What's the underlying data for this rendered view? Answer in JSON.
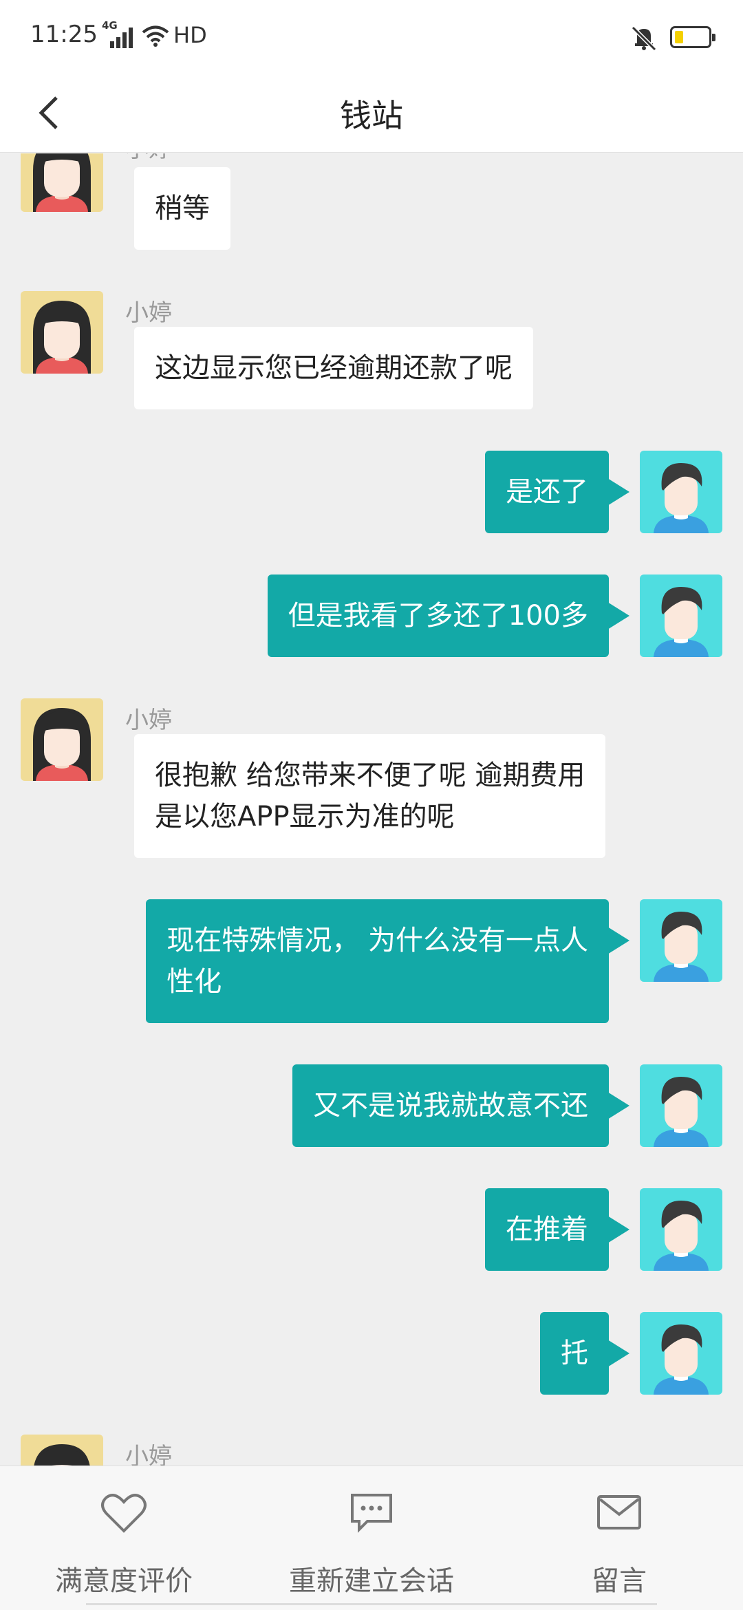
{
  "status_bar": {
    "time": "11:25",
    "network": "4G",
    "hd": "HD"
  },
  "header": {
    "title": "钱站"
  },
  "colors": {
    "accent": "#13a9a7",
    "agent_avatar_bg": "#f0dc97",
    "user_avatar_bg": "#4fdde0"
  },
  "messages": [
    {
      "sender": "小婷",
      "text": "稍等"
    },
    {
      "sender": "小婷",
      "text": "这边显示您已经逾期还款了呢"
    },
    {
      "text": "是还了"
    },
    {
      "text": "但是我看了多还了100多"
    },
    {
      "sender": "小婷",
      "lines": [
        "很抱歉 给您带来不便了呢 逾期费用",
        "是以您APP显示为准的呢"
      ]
    },
    {
      "lines": [
        "现在特殊情况， 为什么没有一点人",
        "性化"
      ]
    },
    {
      "text": "又不是说我就故意不还"
    },
    {
      "text": "在推着"
    },
    {
      "text": "托"
    },
    {
      "sender": "小婷"
    }
  ],
  "bottom_bar": {
    "rate": "满意度评价",
    "new_session": "重新建立会话",
    "leave_message": "留言"
  }
}
